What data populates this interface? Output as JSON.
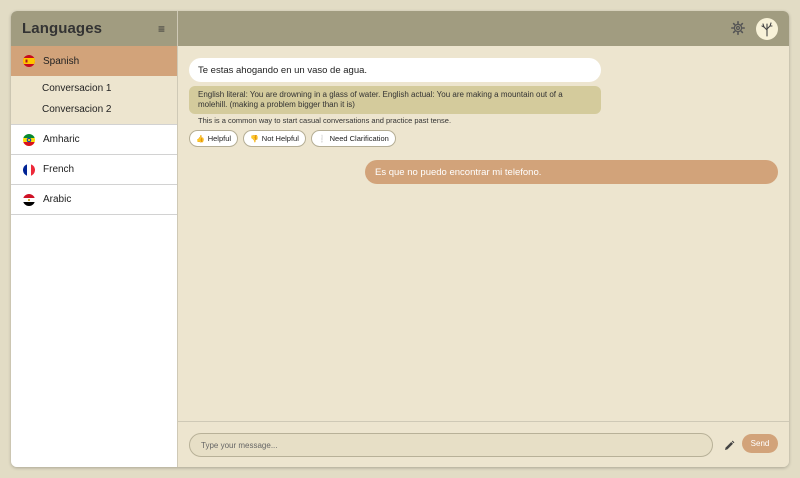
{
  "sidebar": {
    "title": "Languages",
    "menu_icon": "hamburger-icon",
    "languages": [
      {
        "label": "Spanish",
        "icon": "spain-flag-icon",
        "active": true,
        "conversations": [
          "Conversacion 1",
          "Conversacion 2"
        ]
      },
      {
        "label": "Amharic",
        "icon": "ethiopia-flag-icon"
      },
      {
        "label": "French",
        "icon": "france-flag-icon"
      },
      {
        "label": "Arabic",
        "icon": "egypt-flag-icon"
      }
    ]
  },
  "header": {
    "settings_icon": "gear-icon",
    "avatar_icon": "tree-avatar-icon"
  },
  "chat": {
    "bot_message": "Te estas ahogando en un vaso de agua.",
    "explanation": "English literal: You are drowning in a glass of water. English actual: You are making a mountain out of a molehill. (making a problem bigger than it is)",
    "note": "This is a common way to start casual conversations and practice past tense.",
    "feedback": [
      {
        "icon": "thumbs-up-icon",
        "glyph": "👍",
        "label": "Helpful"
      },
      {
        "icon": "thumbs-down-icon",
        "glyph": "👎",
        "label": "Not Helpful"
      },
      {
        "icon": "question-icon",
        "glyph": "❕",
        "label": "Need Clarification"
      }
    ],
    "user_message": "Es que no puedo encontrar mi telefono."
  },
  "composer": {
    "placeholder": "Type your message...",
    "value": "",
    "pencil_icon": "pencil-icon",
    "send_label": "Send"
  },
  "colors": {
    "header": "#a19c80",
    "accent": "#d2a37a",
    "background": "#ede5cf",
    "explanation_bg": "#d4cb9c"
  }
}
